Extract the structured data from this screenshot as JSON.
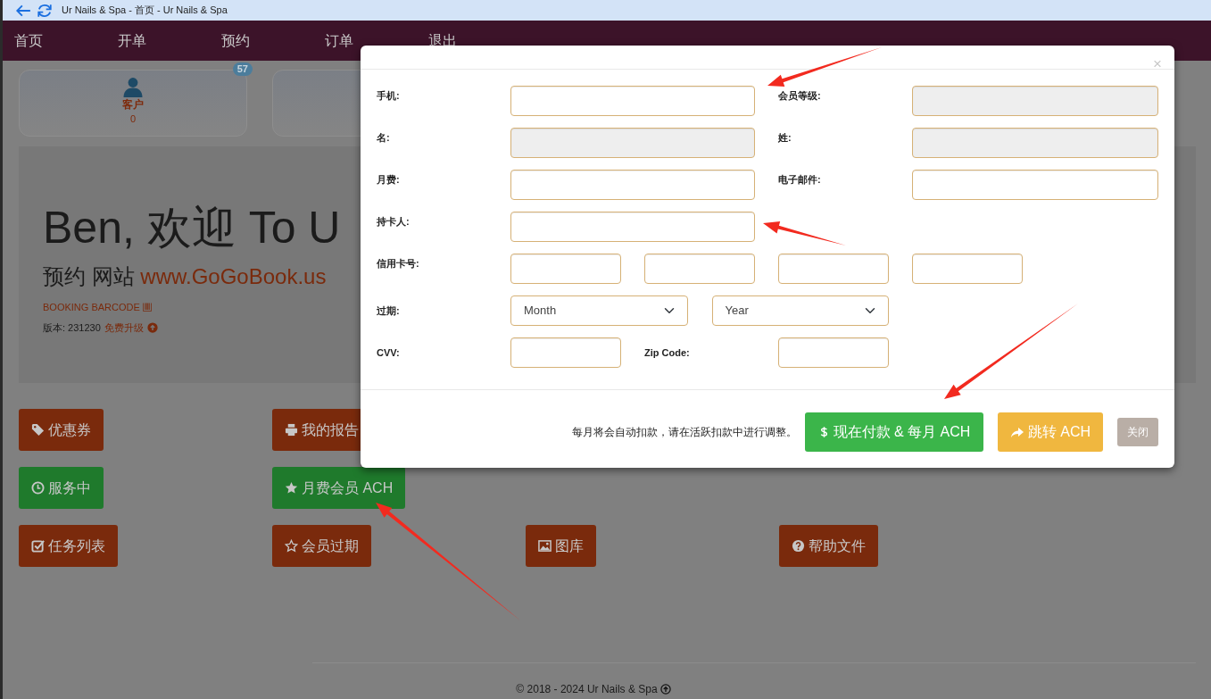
{
  "browser": {
    "title": "Ur Nails & Spa - 首页 - Ur Nails & Spa"
  },
  "nav": [
    "首页",
    "开单",
    "预约",
    "订单",
    "退出"
  ],
  "cards": [
    {
      "kind": "full",
      "label": "客户",
      "count": "0",
      "badge": "57"
    },
    {
      "kind": "covered"
    }
  ],
  "welcome": {
    "heading": "Ben, 欢迎 To U",
    "site_label": "预约 网站",
    "site_link": "www.GoGoBook.us",
    "barcode_link": "BOOKING BARCODE",
    "version_label": "版本: 231230",
    "upgrade_link": "免费升级"
  },
  "tiles": [
    [
      {
        "label": "优惠券",
        "kind": "tag",
        "color": "#7a2a0c"
      },
      {
        "label": "我的报告",
        "kind": "printer",
        "color": "#7a2a0c"
      }
    ],
    [
      {
        "label": "服务中",
        "kind": "clock",
        "color": "#1f7a2c"
      },
      {
        "label": "月费会员 ACH",
        "kind": "star",
        "color": "#1f7a2c"
      }
    ],
    [
      {
        "label": "任务列表",
        "kind": "check",
        "color": "#7a2a0c"
      },
      {
        "label": "会员过期",
        "kind": "star_outline",
        "color": "#7a2a0c"
      },
      {
        "label": "图库",
        "kind": "image",
        "color": "#7a2a0c"
      },
      {
        "label": "帮助文件",
        "kind": "question",
        "color": "#7a2a0c"
      }
    ]
  ],
  "footer": {
    "text": "© 2018 - 2024 Ur Nails & Spa"
  },
  "modal": {
    "close": "×",
    "rows": [
      {
        "kind": "pair",
        "cells": [
          {
            "kind": "label",
            "text": "手机:"
          },
          {
            "kind": "input",
            "disabled": false
          },
          {
            "kind": "label",
            "text": "会员等级:"
          },
          {
            "kind": "input",
            "disabled": true
          }
        ]
      },
      {
        "kind": "pair",
        "cells": [
          {
            "kind": "label",
            "text": "名:"
          },
          {
            "kind": "input",
            "disabled": true
          },
          {
            "kind": "label",
            "text": "姓:"
          },
          {
            "kind": "input",
            "disabled": true
          }
        ]
      },
      {
        "kind": "pair",
        "cells": [
          {
            "kind": "label",
            "text": "月费:"
          },
          {
            "kind": "input",
            "disabled": false
          },
          {
            "kind": "label",
            "text": "电子邮件:"
          },
          {
            "kind": "input",
            "disabled": false
          }
        ]
      },
      {
        "kind": "single",
        "cells": [
          {
            "kind": "label",
            "text": "持卡人:"
          },
          {
            "kind": "input",
            "disabled": false
          }
        ]
      },
      {
        "kind": "split",
        "cells": [
          {
            "kind": "label",
            "text": "信用卡号:"
          },
          {
            "kind": "input",
            "disabled": false
          },
          {
            "kind": "input",
            "disabled": false
          },
          {
            "kind": "input",
            "disabled": false
          },
          {
            "kind": "input",
            "disabled": false
          }
        ]
      },
      {
        "kind": "expiry",
        "cells": [
          {
            "kind": "label",
            "text": "过期:"
          },
          {
            "kind": "select",
            "value": "Month"
          },
          {
            "kind": "select",
            "value": "Year"
          }
        ]
      },
      {
        "kind": "small_pair",
        "cells": [
          {
            "kind": "label",
            "text": "CVV:"
          },
          {
            "kind": "input",
            "disabled": false
          },
          {
            "kind": "label",
            "text": "Zip Code:"
          },
          {
            "kind": "input",
            "disabled": false
          }
        ]
      }
    ],
    "note": "每月将会自动扣款，请在活跃扣款中进行调整。",
    "buttons": [
      {
        "kind": "pay",
        "label": "现在付款 & 每月 ACH"
      },
      {
        "kind": "redirect",
        "label": "跳转 ACH"
      },
      {
        "kind": "close",
        "label": "关闭"
      }
    ]
  }
}
